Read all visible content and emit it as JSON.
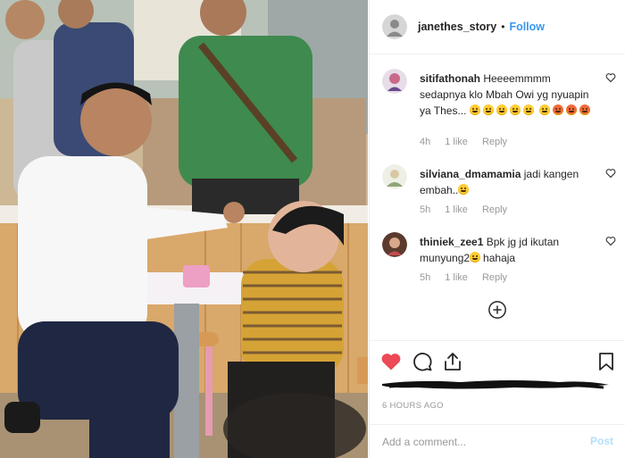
{
  "post": {
    "author": "janethes_story",
    "separator": "•",
    "follow_label": "Follow",
    "avatar_icon": "user-avatar-icon"
  },
  "comments": [
    {
      "username": "sitifathonah",
      "text": "Heeeemmmm sedapnya klo Mbah Owi yg nyuapin ya Thes...",
      "emoji_row1": [
        "crying-face",
        "crying-face",
        "crying-face",
        "smile-face",
        "smile-face"
      ],
      "emoji_row2": [
        "grin-face",
        "star-struck-face",
        "star-struck-face",
        "star-struck-face"
      ],
      "time": "4h",
      "likes": "1 like",
      "reply": "Reply"
    },
    {
      "username": "silviana_dmamamia",
      "text": "jadi kangen embah..",
      "emoji": [
        "crying-face"
      ],
      "time": "5h",
      "likes": "1 like",
      "reply": "Reply"
    },
    {
      "username": "thiniek_zee1",
      "text_before": "Bpk jg jd ikutan munyung2",
      "emoji": [
        "sweat-smile-face"
      ],
      "text_after": "hahaja",
      "time": "5h",
      "likes": "1 like",
      "reply": "Reply"
    }
  ],
  "icons": {
    "like": "heart-filled-icon",
    "comment": "comment-bubble-icon",
    "share": "share-icon",
    "save": "bookmark-icon",
    "load_more": "plus-circle-icon",
    "comment_like": "heart-outline-icon"
  },
  "colors": {
    "like_red": "#ed4956",
    "follow_blue": "#3897f0",
    "post_disabled": "#b2dffc",
    "muted_text": "#999999"
  },
  "timestamp": "6 HOURS AGO",
  "add_comment": {
    "placeholder": "Add a comment...",
    "post_label": "Post"
  }
}
